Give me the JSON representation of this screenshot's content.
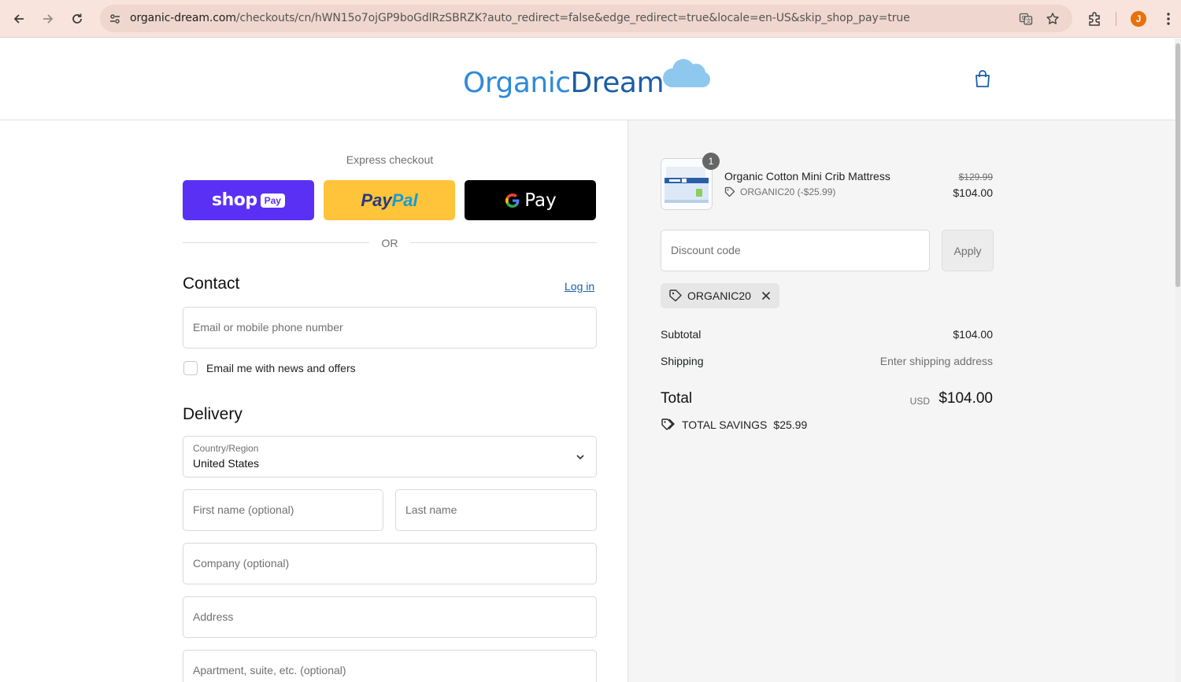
{
  "browser": {
    "url_host": "organic-dream.com",
    "url_path": "/checkouts/cn/hWN15o7ojGP9boGdlRzSBRZK?auto_redirect=false&edge_redirect=true&locale=en-US&skip_shop_pay=true",
    "profile_initial": "J"
  },
  "header": {
    "logo_part1": "Organic",
    "logo_part2": "Dream"
  },
  "checkout": {
    "express_label": "Express checkout",
    "shop_pay": "shop",
    "shop_pay_badge": "Pay",
    "paypal_1": "Pay",
    "paypal_2": "Pal",
    "gpay": "Pay",
    "or_label": "OR",
    "contact_title": "Contact",
    "login_link": "Log in",
    "email_placeholder": "Email or mobile phone number",
    "newsletter_label": "Email me with news and offers",
    "delivery_title": "Delivery",
    "country_label": "Country/Region",
    "country_value": "United States",
    "first_name_placeholder": "First name (optional)",
    "last_name_placeholder": "Last name",
    "company_placeholder": "Company (optional)",
    "address_placeholder": "Address",
    "apartment_placeholder": "Apartment, suite, etc. (optional)"
  },
  "summary": {
    "item": {
      "quantity": "1",
      "name": "Organic Cotton Mini Crib Mattress",
      "discount_line": "ORGANIC20 (-$25.99)",
      "price_original": "$129.99",
      "price_current": "$104.00"
    },
    "discount_placeholder": "Discount code",
    "apply_label": "Apply",
    "applied_code": "ORGANIC20",
    "subtotal_label": "Subtotal",
    "subtotal_value": "$104.00",
    "shipping_label": "Shipping",
    "shipping_value": "Enter shipping address",
    "total_label": "Total",
    "total_currency": "USD",
    "total_value": "$104.00",
    "savings_label": "TOTAL SAVINGS",
    "savings_value": "$25.99"
  },
  "colors": {
    "shop_pay": "#5a31f4",
    "paypal": "#ffc439",
    "gpay": "#000000",
    "link": "#1b5ea6",
    "chrome_bar": "#f8e4dc"
  }
}
